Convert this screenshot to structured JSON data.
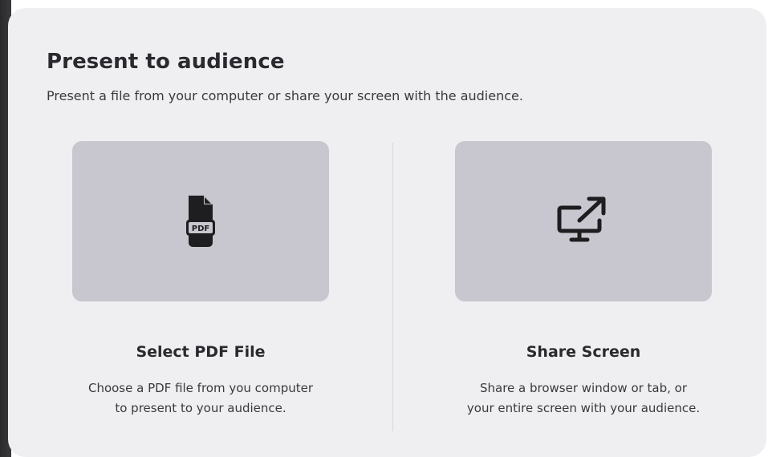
{
  "dialog": {
    "title": "Present to audience",
    "subtitle": "Present a file from your computer or share your screen with the audience."
  },
  "options": [
    {
      "icon": "pdf-file-icon",
      "title": "Select PDF File",
      "description_lines": [
        "Choose a PDF file from you computer",
        "to present to your audience."
      ],
      "icon_label": "PDF"
    },
    {
      "icon": "share-screen-icon",
      "title": "Share Screen",
      "description_lines": [
        "Share a browser window or tab, or",
        "your entire screen with your audience."
      ]
    }
  ],
  "colors": {
    "dialog_bg": "#efeef1",
    "tile_bg": "#c8c7cf",
    "text_primary": "#2a2a2e",
    "icon": "#1e1e20"
  }
}
